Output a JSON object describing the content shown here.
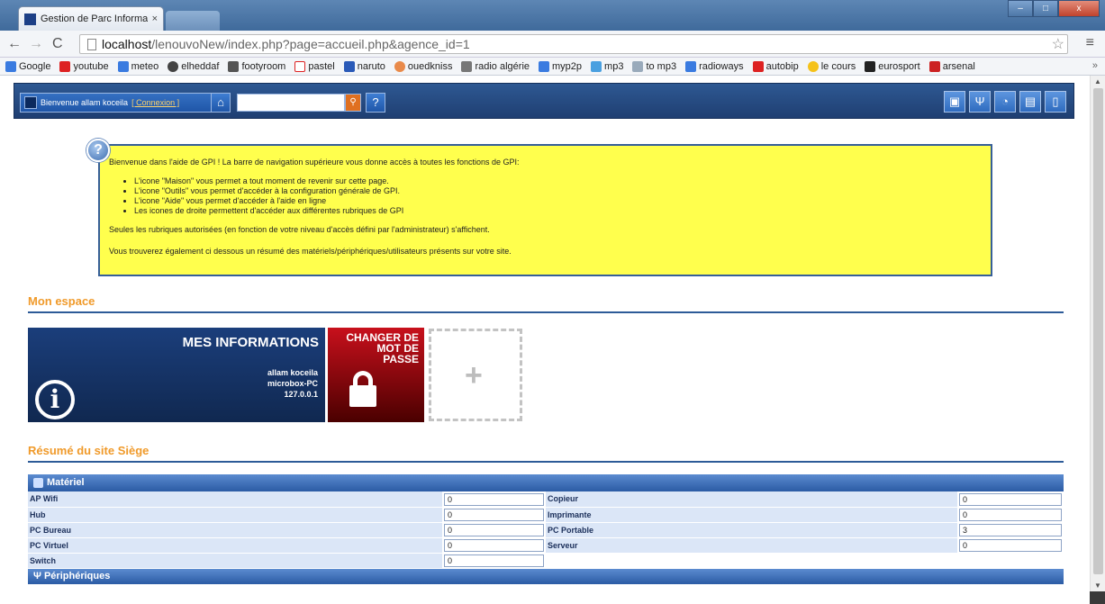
{
  "browser": {
    "tab_title": "Gestion de Parc Informati",
    "tab_close": "×",
    "url_host": "localhost",
    "url_rest": "/lenouvoNew/index.php?page=accueil.php&agence_id=1",
    "win_min": "–",
    "win_max": "□",
    "win_close": "x",
    "bookmarks": [
      "Google",
      "youtube",
      "meteo",
      "elheddaf",
      "footyroom",
      "pastel",
      "naruto",
      "ouedkniss",
      "radio algérie",
      "myp2p",
      "mp3",
      "to mp3",
      "radioways",
      "autobip",
      "le cours",
      "eurosport",
      "arsenal"
    ],
    "bookmark_more": "»"
  },
  "appbar": {
    "welcome": "Bienvenue allam koceila",
    "connexion": "[ Connexion ]",
    "search_placeholder": "",
    "help_label": "?"
  },
  "help": {
    "intro": "Bienvenue dans l'aide de GPI ! La barre de navigation supérieure vous donne accès à toutes les fonctions de GPI:",
    "bullets": [
      "L'icone \"Maison\" vous permet a tout moment de revenir sur cette page.",
      "L'icone \"Outils\" vous permet d'accéder à la configuration générale de GPI.",
      "L'icone \"Aide\" vous permet d'accéder à l'aide en ligne",
      "Les icones de droite permettent d'accéder aux différentes rubriques de GPI"
    ],
    "note1": "Seules les rubriques autorisées (en fonction de votre niveau d'accès défini par l'administrateur) s'affichent.",
    "note2": "Vous trouverez également ci dessous un résumé des matériels/périphériques/utilisateurs présents sur votre site."
  },
  "mon_espace": {
    "title": "Mon espace",
    "info_tile": {
      "title": "MES INFORMATIONS",
      "user": "allam koceila",
      "host": "microbox-PC",
      "ip": "127.0.0.1"
    },
    "pwd_tile": {
      "line1": "CHANGER DE",
      "line2": "MOT DE",
      "line3": "PASSE"
    },
    "add_tile": "+"
  },
  "resume": {
    "title": "Résumé du site Siège",
    "materiel_label": "Matériel",
    "rows": [
      {
        "l1": "AP Wifi",
        "v1": "0",
        "l2": "Copieur",
        "v2": "0"
      },
      {
        "l1": "Hub",
        "v1": "0",
        "l2": "Imprimante",
        "v2": "0"
      },
      {
        "l1": "PC Bureau",
        "v1": "0",
        "l2": "PC Portable",
        "v2": "3"
      },
      {
        "l1": "PC Virtuel",
        "v1": "0",
        "l2": "Serveur",
        "v2": "0"
      },
      {
        "l1": "Switch",
        "v1": "0",
        "l2": "",
        "v2": ""
      }
    ],
    "peripheriques_label": "Périphériques"
  }
}
